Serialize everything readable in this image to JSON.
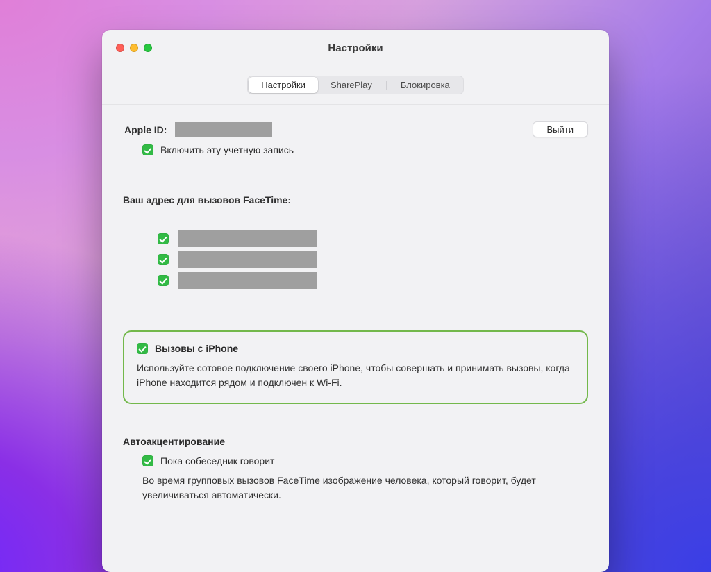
{
  "window": {
    "title": "Настройки"
  },
  "tabs": {
    "settings": "Настройки",
    "shareplay": "SharePlay",
    "blocking": "Блокировка"
  },
  "appleid": {
    "label": "Apple ID:",
    "signout": "Выйти",
    "enable_account": "Включить эту учетную запись"
  },
  "facetime_addresses": {
    "heading": "Ваш адрес для вызовов FaceTime:"
  },
  "iphone_calls": {
    "title": "Вызовы с iPhone",
    "desc": "Используйте сотовое подключение своего iPhone, чтобы совершать и принимать вызовы, когда iPhone находится рядом и подключен к Wi-Fi."
  },
  "auto_prominence": {
    "heading": "Автоакцентирование",
    "checkbox_label": "Пока собеседник говорит",
    "desc": "Во время групповых вызовов FaceTime изображение человека, который говорит, будет увеличиваться автоматически."
  }
}
